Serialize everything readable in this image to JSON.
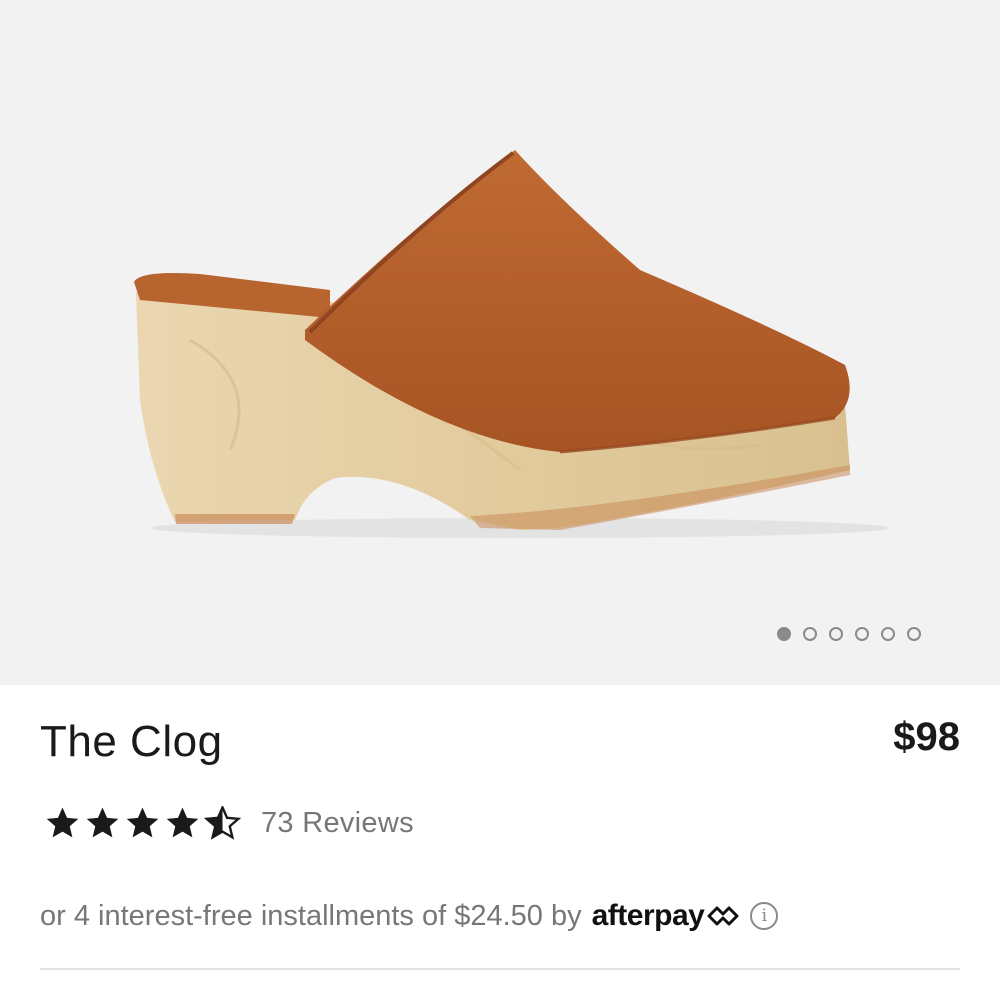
{
  "product": {
    "title": "The Clog",
    "price": "$98",
    "rating": 4.5,
    "rating_max": 5,
    "reviews_label": "73 Reviews"
  },
  "gallery": {
    "image_count": 6,
    "active_index": 0,
    "image_subject": "tan leather clog mule with wooden platform sole"
  },
  "installments": {
    "text": "or 4 interest-free installments of $24.50 by",
    "provider": "afterpay",
    "provider_icon": "afterpay-logo-icon",
    "info_icon": "info-icon"
  },
  "colors": {
    "leather": "#b5602c",
    "wood": "#e4cfa5",
    "hero_bg": "#f2f2f2",
    "star": "#1a1a1a"
  }
}
